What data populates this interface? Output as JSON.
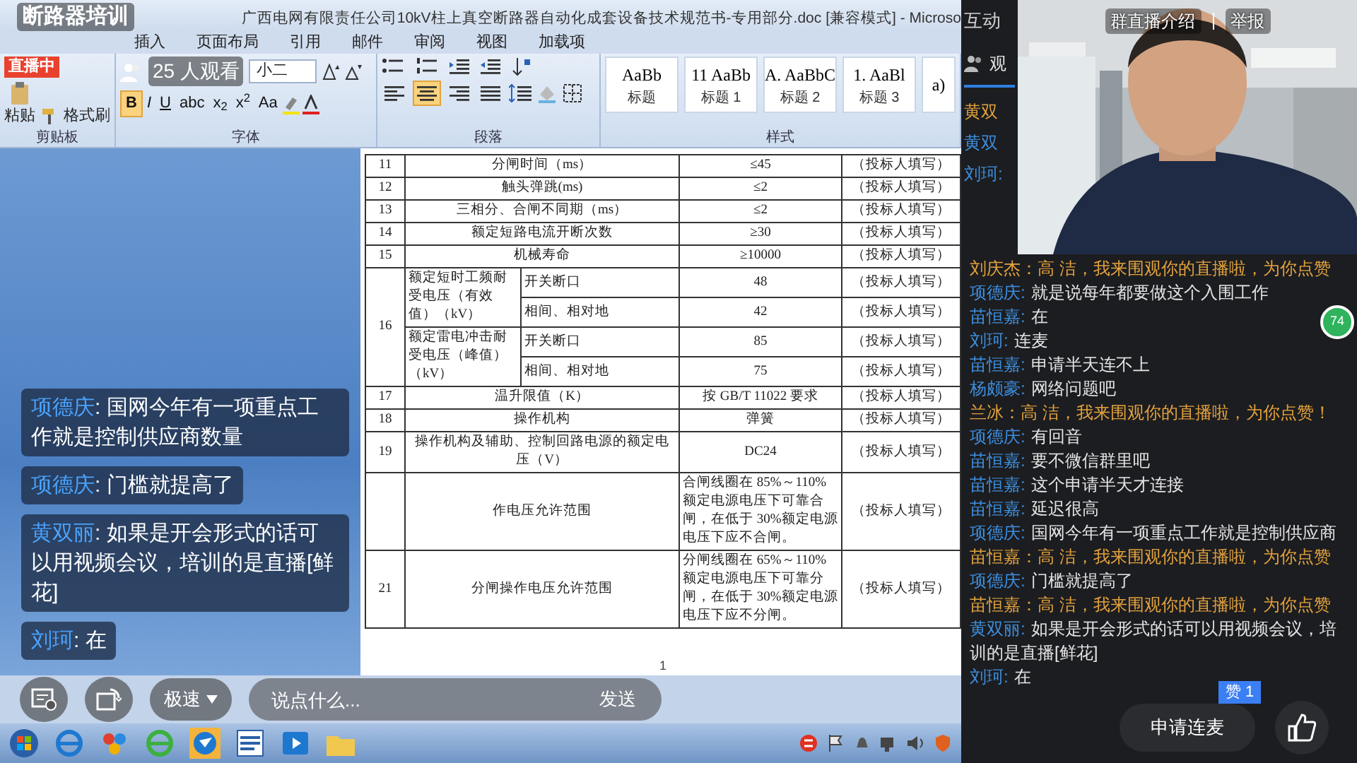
{
  "word_window": {
    "title": "广西电网有限责任公司10kV柱上真空断路器自动化成套设备技术规范书-专用部分.doc [兼容模式] - Microso",
    "tabs": [
      "插入",
      "页面布局",
      "引用",
      "邮件",
      "审阅",
      "视图",
      "加载项"
    ],
    "ribbon": {
      "clipboard": {
        "paste": "粘贴",
        "format_painter": "格式刷",
        "label": "剪贴板"
      },
      "font": {
        "size": "小二",
        "label": "字体",
        "format_buttons": [
          {
            "label": "B",
            "selected": true
          },
          {
            "label": "I",
            "selected": false
          },
          {
            "label": "U",
            "selected": false
          },
          {
            "label": "abc",
            "selected": false
          },
          {
            "label": "x$_{2}$",
            "selected": false
          },
          {
            "label": "x$^{2}$",
            "selected": false
          },
          {
            "label": "Aa",
            "selected": false
          }
        ]
      },
      "paragraph": {
        "label": "段落",
        "align_buttons": [
          {
            "selected": false
          },
          {
            "selected": true
          },
          {
            "selected": false
          },
          {
            "selected": false
          }
        ]
      },
      "styles": {
        "label": "样式",
        "items": [
          {
            "preview": "AaBb",
            "name": "标题"
          },
          {
            "preview": "11  AaBb",
            "name": "标题 1"
          },
          {
            "preview": "A.  AaBbC",
            "name": "标题 2"
          },
          {
            "preview": "1.  AaBl",
            "name": "标题 3"
          },
          {
            "preview": "a)"
          }
        ]
      }
    },
    "document": {
      "rows": [
        {
          "kind": "simple",
          "no": "11",
          "item": "分闸时间（ms）",
          "value": "≤45",
          "fill": "（投标人填写）"
        },
        {
          "kind": "simple",
          "no": "12",
          "item": "触头弹跳(ms)",
          "value": "≤2",
          "fill": "（投标人填写）"
        },
        {
          "kind": "simple",
          "no": "13",
          "item": "三相分、合闸不同期（ms）",
          "value": "≤2",
          "fill": "（投标人填写）"
        },
        {
          "kind": "simple",
          "no": "14",
          "item": "额定短路电流开断次数",
          "value": "≥30",
          "fill": "（投标人填写）"
        },
        {
          "kind": "simple",
          "no": "15",
          "item": "机械寿命",
          "value": "≥10000",
          "fill": "（投标人填写）"
        },
        {
          "kind": "grouped",
          "no": "16",
          "groups": [
            {
              "item": "额定短时工频耐受电压（有效值）（kV）",
              "subs": [
                {
                  "item": "开关断口",
                  "value": "48",
                  "fill": "（投标人填写）"
                },
                {
                  "item": "相间、相对地",
                  "value": "42",
                  "fill": "（投标人填写）"
                }
              ]
            },
            {
              "item": "额定雷电冲击耐受电压（峰值）（kV）",
              "subs": [
                {
                  "item": "开关断口",
                  "value": "85",
                  "fill": "（投标人填写）"
                },
                {
                  "item": "相间、相对地",
                  "value": "75",
                  "fill": "（投标人填写）"
                }
              ]
            }
          ]
        },
        {
          "kind": "simple",
          "no": "17",
          "item": "温升限值（K）",
          "value": "按 GB/T 11022 要求",
          "fill": "（投标人填写）"
        },
        {
          "kind": "simple",
          "no": "18",
          "item": "操作机构",
          "value": "弹簧",
          "fill": "（投标人填写）"
        },
        {
          "kind": "simple",
          "no": "19",
          "item": "操作机构及辅助、控制回路电源的额定电压（V）",
          "value": "DC24",
          "fill": "（投标人填写）"
        },
        {
          "kind": "simple",
          "item": "作电压允许范围",
          "value": "合闸线圈在 85%～110%额定电源电压下可靠合闸，在低于 30%额定电源电压下应不合闸。",
          "fill": "（投标人填写）"
        },
        {
          "kind": "simple",
          "no": "21",
          "item": "分闸操作电压允许范围",
          "value": "分闸线圈在 65%～110%额定电源电压下可靠分闸，在低于 30%额定电源电压下应不分闸。",
          "fill": "（投标人填写）"
        }
      ],
      "page_number": "1"
    }
  },
  "live": {
    "title": "断路器培训",
    "status": "直播中",
    "viewers": "25 人观看",
    "messages": [
      {
        "user": "项德庆",
        "text": ": 国网今年有一项重点工作就是控制供应商数量"
      },
      {
        "user": "项德庆",
        "text": ": 门槛就提高了"
      },
      {
        "user": "黄双丽",
        "text": ": 如果是开会形式的话可以用视频会议，培训的是直播[鲜花]"
      },
      {
        "user": "刘珂",
        "text": ": 在"
      }
    ],
    "controls": {
      "speed": "极速",
      "placeholder": "说点什么...",
      "send": "发送"
    }
  },
  "panel": {
    "tab": "互动",
    "viewers_tab": "观",
    "hidden_users": [
      {
        "user": "黄双",
        "kind": "like"
      },
      {
        "user": "黄双",
        "kind": "chat"
      },
      {
        "user": "刘珂:",
        "kind": "chat"
      }
    ],
    "links": [
      "群直播介绍",
      "举报"
    ],
    "floating_count": "74",
    "messages": [
      {
        "kind": "like",
        "user": "刘庆杰",
        "text": "：高 洁，我来围观你的直播啦，为你点赞"
      },
      {
        "kind": "chat",
        "user": "项德庆:",
        "text": "就是说每年都要做这个入围工作"
      },
      {
        "kind": "chat",
        "user": "苗恒嘉:",
        "text": "在"
      },
      {
        "kind": "chat",
        "user": "刘珂:",
        "text": "连麦"
      },
      {
        "kind": "chat",
        "user": "苗恒嘉:",
        "text": "申请半天连不上"
      },
      {
        "kind": "chat",
        "user": "杨颇豪:",
        "text": "网络问题吧"
      },
      {
        "kind": "like",
        "user": "兰冰",
        "text": "：高 洁，我来围观你的直播啦，为你点赞！"
      },
      {
        "kind": "chat",
        "user": "项德庆:",
        "text": "有回音"
      },
      {
        "kind": "chat",
        "user": "苗恒嘉:",
        "text": "要不微信群里吧"
      },
      {
        "kind": "chat",
        "user": "苗恒嘉:",
        "text": "这个申请半天才连接"
      },
      {
        "kind": "chat",
        "user": "苗恒嘉:",
        "text": "延迟很高"
      },
      {
        "kind": "chat",
        "user": "项德庆:",
        "text": "国网今年有一项重点工作就是控制供应商"
      },
      {
        "kind": "like",
        "user": "苗恒嘉",
        "text": "：高 洁，我来围观你的直播啦，为你点赞"
      },
      {
        "kind": "chat",
        "user": "项德庆:",
        "text": "门槛就提高了"
      },
      {
        "kind": "like",
        "user": "苗恒嘉",
        "text": "：高 洁，我来围观你的直播啦，为你点赞"
      },
      {
        "kind": "chat",
        "user": "黄双丽:",
        "text": "如果是开会形式的话可以用视频会议，培训的是直播[鲜花]"
      },
      {
        "kind": "chat",
        "user": "刘珂:",
        "text": "在"
      }
    ],
    "mic_button": "申请连麦",
    "likes": "赞 1"
  }
}
